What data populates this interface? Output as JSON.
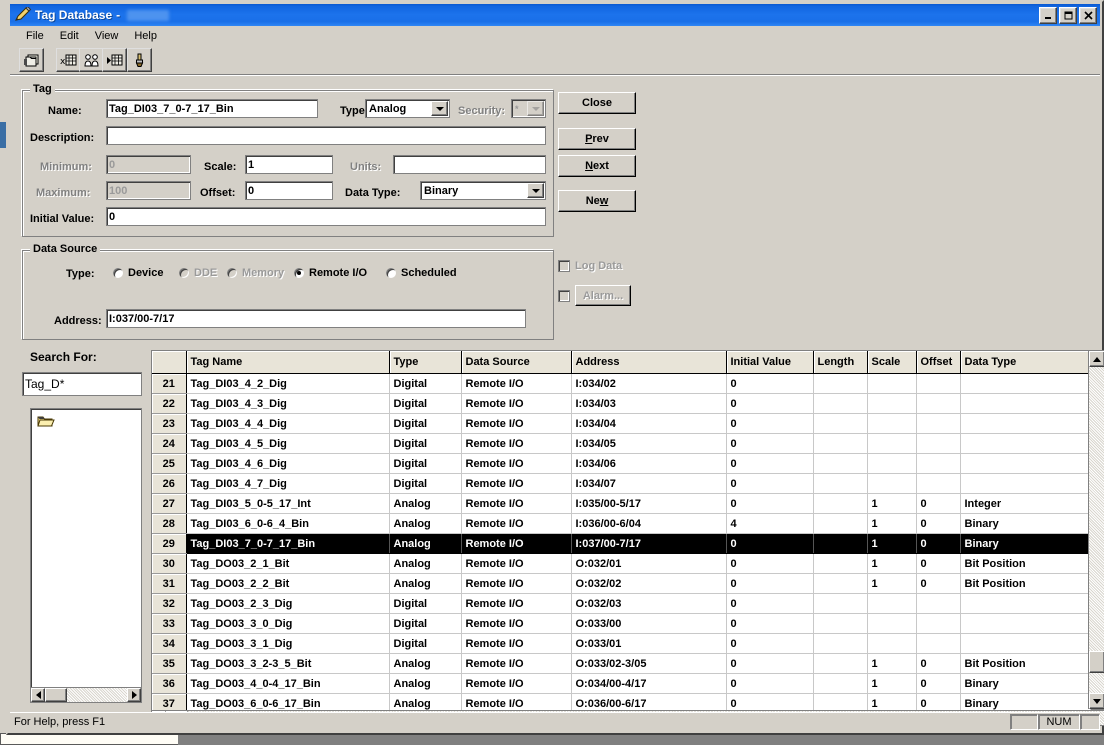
{
  "window": {
    "title": "Tag Database",
    "title_separator": "-",
    "title_redacted": true,
    "icon": "tag-pencil-icon",
    "buttons": {
      "minimize": "_",
      "maximize": "□",
      "close": "✕"
    }
  },
  "menu": {
    "items": [
      "File",
      "Edit",
      "View",
      "Help"
    ]
  },
  "toolbar": {
    "buttons": [
      {
        "name": "copy-tag-button",
        "icon": "copy-records-icon"
      },
      {
        "name": "delete-tag-button",
        "icon": "delete-record-icon"
      },
      {
        "name": "users-button",
        "icon": "two-persons-icon"
      },
      {
        "name": "goto-record-button",
        "icon": "goto-record-icon"
      },
      {
        "name": "cleanup-button",
        "icon": "brush-icon"
      }
    ]
  },
  "tag_group": {
    "legend": "Tag",
    "name_label": "Name:",
    "name_value": "Tag_DI03_7_0-7_17_Bin",
    "type_label": "Type:",
    "type_value": "Analog",
    "security_label": "Security:",
    "security_value": "*",
    "description_label": "Description:",
    "description_value": "",
    "minimum_label": "Minimum:",
    "minimum_value": "0",
    "scale_label": "Scale:",
    "scale_value": "1",
    "units_label": "Units:",
    "units_value": "",
    "maximum_label": "Maximum:",
    "maximum_value": "100",
    "offset_label": "Offset:",
    "offset_value": "0",
    "datatype_label": "Data Type:",
    "datatype_value": "Binary",
    "initial_label": "Initial Value:",
    "initial_value": "0"
  },
  "data_source_group": {
    "legend": "Data Source",
    "type_label": "Type:",
    "options": [
      {
        "label": "Device",
        "selected": false,
        "enabled": true
      },
      {
        "label": "DDE",
        "selected": false,
        "enabled": false
      },
      {
        "label": "Memory",
        "selected": false,
        "enabled": false
      },
      {
        "label": "Remote I/O",
        "selected": true,
        "enabled": true
      },
      {
        "label": "Scheduled",
        "selected": false,
        "enabled": true
      }
    ],
    "address_label": "Address:",
    "address_value": "I:037/00-7/17"
  },
  "side_options": {
    "log_data_label": "Log Data",
    "log_data_checked": false,
    "alarm_label": "Alarm...",
    "alarm_checked": false
  },
  "action_buttons": [
    {
      "name": "close-button",
      "label": "Close",
      "accel": ""
    },
    {
      "name": "prev-button",
      "label": "Prev",
      "accel": "P"
    },
    {
      "name": "next-button",
      "label": "Next",
      "accel": "N"
    },
    {
      "name": "new-button",
      "label": "New",
      "accel": "w"
    }
  ],
  "search_pane": {
    "label": "Search For:",
    "value": "Tag_D*",
    "placeholder": "",
    "tree_root_icon": "open-folder-icon"
  },
  "grid": {
    "columns": [
      "Tag Name",
      "Type",
      "Data Source",
      "Address",
      "Initial Value",
      "Length",
      "Scale",
      "Offset",
      "Data Type"
    ],
    "selected_row": 29,
    "rows": [
      {
        "n": "21",
        "tag": "Tag_DI03_4_2_Dig",
        "type": "Digital",
        "source": "Remote I/O",
        "address": "I:034/02",
        "initial": "0",
        "length": "",
        "scale": "",
        "offset": "",
        "datatype": ""
      },
      {
        "n": "22",
        "tag": "Tag_DI03_4_3_Dig",
        "type": "Digital",
        "source": "Remote I/O",
        "address": "I:034/03",
        "initial": "0",
        "length": "",
        "scale": "",
        "offset": "",
        "datatype": ""
      },
      {
        "n": "23",
        "tag": "Tag_DI03_4_4_Dig",
        "type": "Digital",
        "source": "Remote I/O",
        "address": "I:034/04",
        "initial": "0",
        "length": "",
        "scale": "",
        "offset": "",
        "datatype": ""
      },
      {
        "n": "24",
        "tag": "Tag_DI03_4_5_Dig",
        "type": "Digital",
        "source": "Remote I/O",
        "address": "I:034/05",
        "initial": "0",
        "length": "",
        "scale": "",
        "offset": "",
        "datatype": ""
      },
      {
        "n": "25",
        "tag": "Tag_DI03_4_6_Dig",
        "type": "Digital",
        "source": "Remote I/O",
        "address": "I:034/06",
        "initial": "0",
        "length": "",
        "scale": "",
        "offset": "",
        "datatype": ""
      },
      {
        "n": "26",
        "tag": "Tag_DI03_4_7_Dig",
        "type": "Digital",
        "source": "Remote I/O",
        "address": "I:034/07",
        "initial": "0",
        "length": "",
        "scale": "",
        "offset": "",
        "datatype": ""
      },
      {
        "n": "27",
        "tag": "Tag_DI03_5_0-5_17_Int",
        "type": "Analog",
        "source": "Remote I/O",
        "address": "I:035/00-5/17",
        "initial": "0",
        "length": "",
        "scale": "1",
        "offset": "0",
        "datatype": "Integer"
      },
      {
        "n": "28",
        "tag": "Tag_DI03_6_0-6_4_Bin",
        "type": "Analog",
        "source": "Remote I/O",
        "address": "I:036/00-6/04",
        "initial": "4",
        "length": "",
        "scale": "1",
        "offset": "0",
        "datatype": "Binary"
      },
      {
        "n": "29",
        "tag": "Tag_DI03_7_0-7_17_Bin",
        "type": "Analog",
        "source": "Remote I/O",
        "address": "I:037/00-7/17",
        "initial": "0",
        "length": "",
        "scale": "1",
        "offset": "0",
        "datatype": "Binary",
        "selected": true
      },
      {
        "n": "30",
        "tag": "Tag_DO03_2_1_Bit",
        "type": "Analog",
        "source": "Remote I/O",
        "address": "O:032/01",
        "initial": "0",
        "length": "",
        "scale": "1",
        "offset": "0",
        "datatype": "Bit Position"
      },
      {
        "n": "31",
        "tag": "Tag_DO03_2_2_Bit",
        "type": "Analog",
        "source": "Remote I/O",
        "address": "O:032/02",
        "initial": "0",
        "length": "",
        "scale": "1",
        "offset": "0",
        "datatype": "Bit Position"
      },
      {
        "n": "32",
        "tag": "Tag_DO03_2_3_Dig",
        "type": "Digital",
        "source": "Remote I/O",
        "address": "O:032/03",
        "initial": "0",
        "length": "",
        "scale": "",
        "offset": "",
        "datatype": ""
      },
      {
        "n": "33",
        "tag": "Tag_DO03_3_0_Dig",
        "type": "Digital",
        "source": "Remote I/O",
        "address": "O:033/00",
        "initial": "0",
        "length": "",
        "scale": "",
        "offset": "",
        "datatype": ""
      },
      {
        "n": "34",
        "tag": "Tag_DO03_3_1_Dig",
        "type": "Digital",
        "source": "Remote I/O",
        "address": "O:033/01",
        "initial": "0",
        "length": "",
        "scale": "",
        "offset": "",
        "datatype": ""
      },
      {
        "n": "35",
        "tag": "Tag_DO03_3_2-3_5_Bit",
        "type": "Analog",
        "source": "Remote I/O",
        "address": "O:033/02-3/05",
        "initial": "0",
        "length": "",
        "scale": "1",
        "offset": "0",
        "datatype": "Bit Position"
      },
      {
        "n": "36",
        "tag": "Tag_DO03_4_0-4_17_Bin",
        "type": "Analog",
        "source": "Remote I/O",
        "address": "O:034/00-4/17",
        "initial": "0",
        "length": "",
        "scale": "1",
        "offset": "0",
        "datatype": "Binary"
      },
      {
        "n": "37",
        "tag": "Tag_DO03_6_0-6_17_Bin",
        "type": "Analog",
        "source": "Remote I/O",
        "address": "O:036/00-6/17",
        "initial": "0",
        "length": "",
        "scale": "1",
        "offset": "0",
        "datatype": "Binary"
      }
    ]
  },
  "statusbar": {
    "help_text": "For Help, press F1",
    "num_indicator": "NUM"
  }
}
